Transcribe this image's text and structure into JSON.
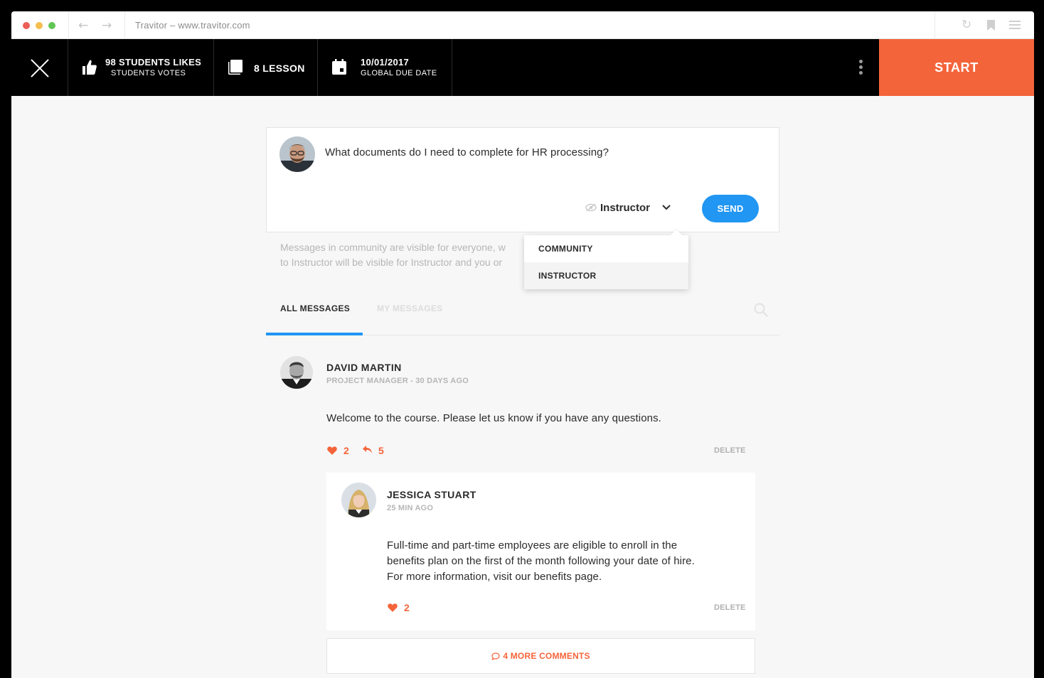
{
  "browser": {
    "url_text": "Travitor – www.travitor.com",
    "traffic_lights": [
      "#ec5f57",
      "#f4be4f",
      "#62c554"
    ]
  },
  "topbar": {
    "likes_title": "98 STUDENTS LIKES",
    "likes_sub": "STUDENTS VOTES",
    "lessons": "8 LESSON",
    "due_date": "10/01/2017",
    "due_label": "GLOBAL DUE DATE",
    "start_label": "START"
  },
  "compose": {
    "text": "What documents do I need to complete for HR processing?",
    "visibility": "Instructor",
    "send_label": "SEND"
  },
  "dropdown": {
    "items": [
      "COMMUNITY",
      "INSTRUCTOR"
    ],
    "selected": "INSTRUCTOR"
  },
  "info": {
    "line1": "Messages in community are visible for everyone, w",
    "line2": "to Instructor will be visible for Instructor and you or"
  },
  "tabs": {
    "all": "ALL MESSAGES",
    "mine": "MY MESSAGES",
    "active": "ALL MESSAGES"
  },
  "messages": [
    {
      "name": "DAVID MARTIN",
      "meta": "PROJECT MANAGER - 30 DAYS AGO",
      "body": "Welcome to the course. Please let us know if you have any questions.",
      "likes": "2",
      "replies": "5",
      "delete_label": "DELETE",
      "reply": {
        "name": "JESSICA STUART",
        "meta": "25 MIN AGO",
        "body_lines": [
          "Full-time and part-time employees are eligible to enroll in the",
          "benefits plan on the first of the month following your date of hire.",
          "For more information, visit our benefits page."
        ],
        "likes": "2",
        "delete_label": "DELETE"
      }
    }
  ],
  "more_comments": "4 MORE COMMENTS",
  "colors": {
    "accent_orange": "#f4643a",
    "accent_blue": "#2196f3"
  }
}
